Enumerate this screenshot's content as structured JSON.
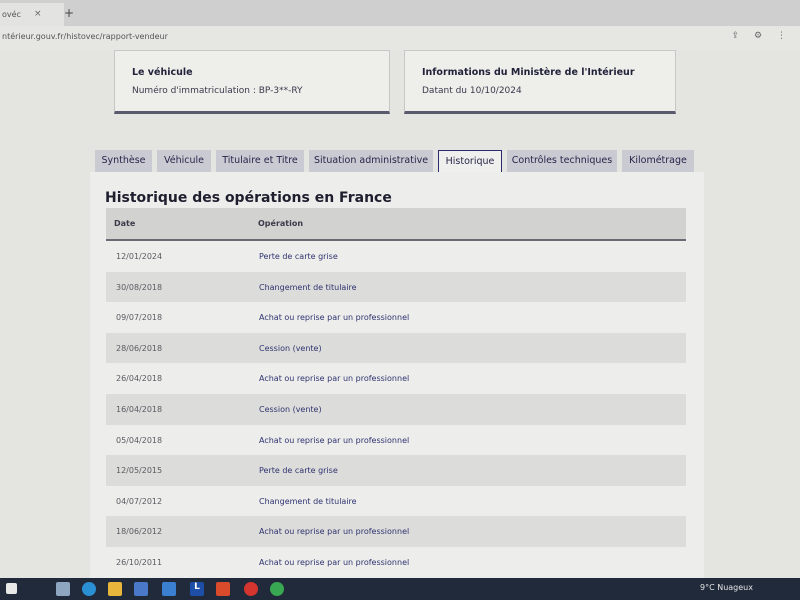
{
  "browser": {
    "tab_title": "ovéc",
    "tab_close": "×",
    "new_tab": "+",
    "url": "ntérieur.gouv.fr/histovec/rapport-vendeur",
    "icons": [
      "share-icon",
      "settings-icon",
      "more-icon"
    ]
  },
  "cards": {
    "vehicule": {
      "title": "Le véhicule",
      "text": "Numéro d'immatriculation : BP-3**-RY"
    },
    "ministere": {
      "title": "Informations du Ministère de l'Intérieur",
      "text": "Datant du 10/10/2024"
    }
  },
  "tabs": [
    {
      "label": "Synthèse",
      "active": false
    },
    {
      "label": "Véhicule",
      "active": false
    },
    {
      "label": "Titulaire et Titre",
      "active": false
    },
    {
      "label": "Situation administrative",
      "active": false
    },
    {
      "label": "Historique",
      "active": true
    },
    {
      "label": "Contrôles techniques",
      "active": false
    },
    {
      "label": "Kilométrage",
      "active": false
    }
  ],
  "history": {
    "title": "Historique des opérations en France",
    "columns": {
      "date": "Date",
      "operation": "Opération"
    },
    "rows": [
      {
        "date": "12/01/2024",
        "operation": "Perte de carte grise"
      },
      {
        "date": "30/08/2018",
        "operation": "Changement de titulaire"
      },
      {
        "date": "09/07/2018",
        "operation": "Achat ou reprise par un professionnel"
      },
      {
        "date": "28/06/2018",
        "operation": "Cession (vente)"
      },
      {
        "date": "26/04/2018",
        "operation": "Achat ou reprise par un professionnel"
      },
      {
        "date": "16/04/2018",
        "operation": "Cession (vente)"
      },
      {
        "date": "05/04/2018",
        "operation": "Achat ou reprise par un professionnel"
      },
      {
        "date": "12/05/2015",
        "operation": "Perte de carte grise"
      },
      {
        "date": "04/07/2012",
        "operation": "Changement de titulaire"
      },
      {
        "date": "18/06/2012",
        "operation": "Achat ou reprise par un professionnel"
      },
      {
        "date": "26/10/2011",
        "operation": "Achat ou reprise par un professionnel"
      }
    ]
  },
  "taskbar": {
    "weather": "9°C  Nuageux",
    "apps": [
      "windows-start-icon",
      "search-icon",
      "task-view-icon",
      "edge-icon",
      "file-explorer-icon",
      "store-icon",
      "mail-icon",
      "app-l-icon",
      "office-icon",
      "opera-icon",
      "chrome-icon",
      "chrome-profile-icon"
    ],
    "colors": {
      "bar": "#202a3a",
      "accent": "#2b2b70"
    }
  }
}
